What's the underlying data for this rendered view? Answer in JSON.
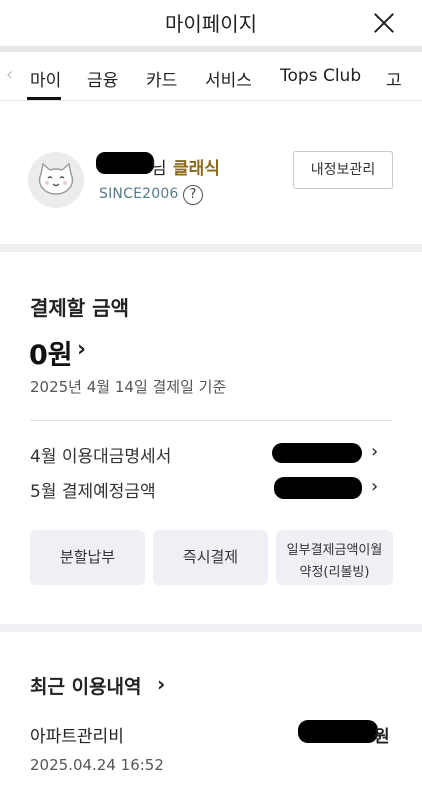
{
  "header": {
    "title": "마이페이지",
    "close_icon": "close-icon"
  },
  "tabs": {
    "left_arrow": "‹",
    "items": [
      {
        "label": "마이",
        "active": true
      },
      {
        "label": "금융"
      },
      {
        "label": "카드"
      },
      {
        "label": "서비스"
      },
      {
        "label": "Tops Club"
      },
      {
        "label": "고"
      }
    ]
  },
  "profile": {
    "name_suffix": "님",
    "grade": "클래식",
    "since": "SINCE2006",
    "help": "?",
    "info_button": "내정보관리",
    "grade_color": "#8a6a1d"
  },
  "payment": {
    "title": "결제할 금액",
    "amount": "0원",
    "date": "2025년 4월 14일 결제일 기준",
    "rows": [
      {
        "label": "4월 이용대금명세서"
      },
      {
        "label": "5월 결제예정금액"
      }
    ],
    "buttons": [
      {
        "label": "분할납부"
      },
      {
        "label": "즉시결제"
      },
      {
        "line1": "일부결제금액이월",
        "line2": "약정(리볼빙)"
      }
    ]
  },
  "recent": {
    "title": "최근 이용내역",
    "items": [
      {
        "name": "아파트관리비",
        "amount_suffix": "원",
        "date": "2025.04.24 16:52"
      }
    ]
  },
  "colors": {
    "divider": "#eef0f3",
    "button_bg": "#eef0f5",
    "since": "#557c8a"
  }
}
